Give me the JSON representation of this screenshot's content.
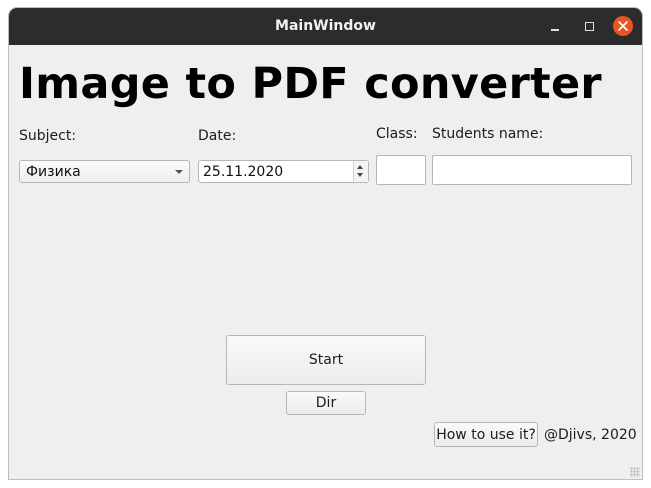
{
  "window": {
    "title": "MainWindow",
    "controls": {
      "minimize_icon": "minimize-icon",
      "maximize_icon": "maximize-icon",
      "close_icon": "close-icon",
      "close_color": "#e95420"
    }
  },
  "main": {
    "heading": "Image to PDF converter",
    "labels": {
      "subject": "Subject:",
      "date": "Date:",
      "class": "Class:",
      "students_name": "Students name:"
    },
    "subject_combo": {
      "selected": "Физика"
    },
    "date_spin": {
      "value": "25.11.2020"
    },
    "class_input": {
      "value": ""
    },
    "students_name_input": {
      "value": ""
    },
    "buttons": {
      "start": "Start",
      "dir": "Dir",
      "how_to": "How to use it?"
    },
    "credit": "@Djivs, 2020"
  }
}
